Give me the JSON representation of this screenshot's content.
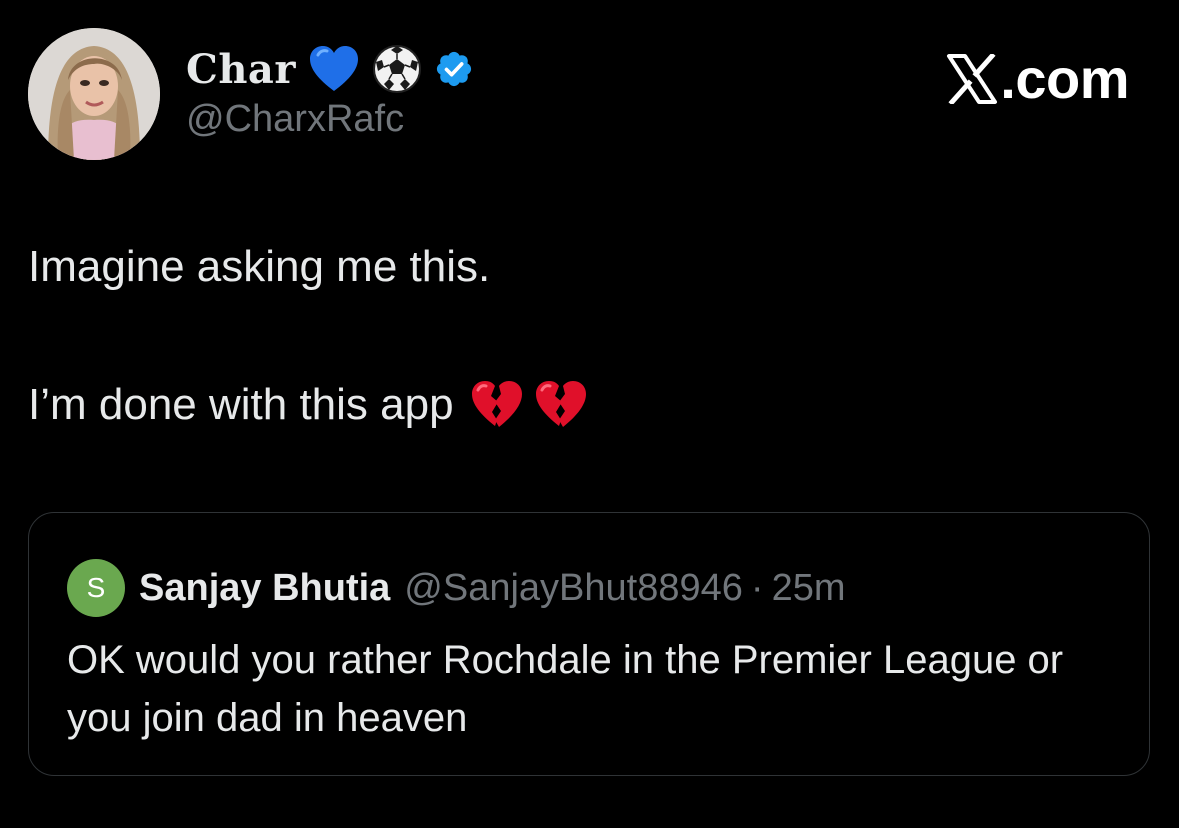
{
  "author": {
    "display_name": "Char",
    "handle": "@CharxRafc",
    "name_emojis": [
      "blue-heart-icon",
      "soccer-ball-icon"
    ],
    "verified": true
  },
  "brand": {
    "label": ".com",
    "logo": "x-logo-icon"
  },
  "tweet": {
    "line1": "Imagine asking me this.",
    "line2": "I’m done with this app",
    "line2_emojis": [
      "broken-heart-icon",
      "broken-heart-icon"
    ]
  },
  "quoted": {
    "avatar_letter": "S",
    "name": "Sanjay Bhutia",
    "handle": "@SanjayBhut88946",
    "separator": "·",
    "time": "25m",
    "text": "OK would you rather Rochdale in the Premier League or you join dad in heaven"
  },
  "colors": {
    "background": "#000000",
    "text_primary": "#e7e9ea",
    "text_secondary": "#71767b",
    "verified_blue": "#1d9bf0",
    "quote_border": "#2f3336",
    "quote_avatar": "#6aa84f"
  }
}
